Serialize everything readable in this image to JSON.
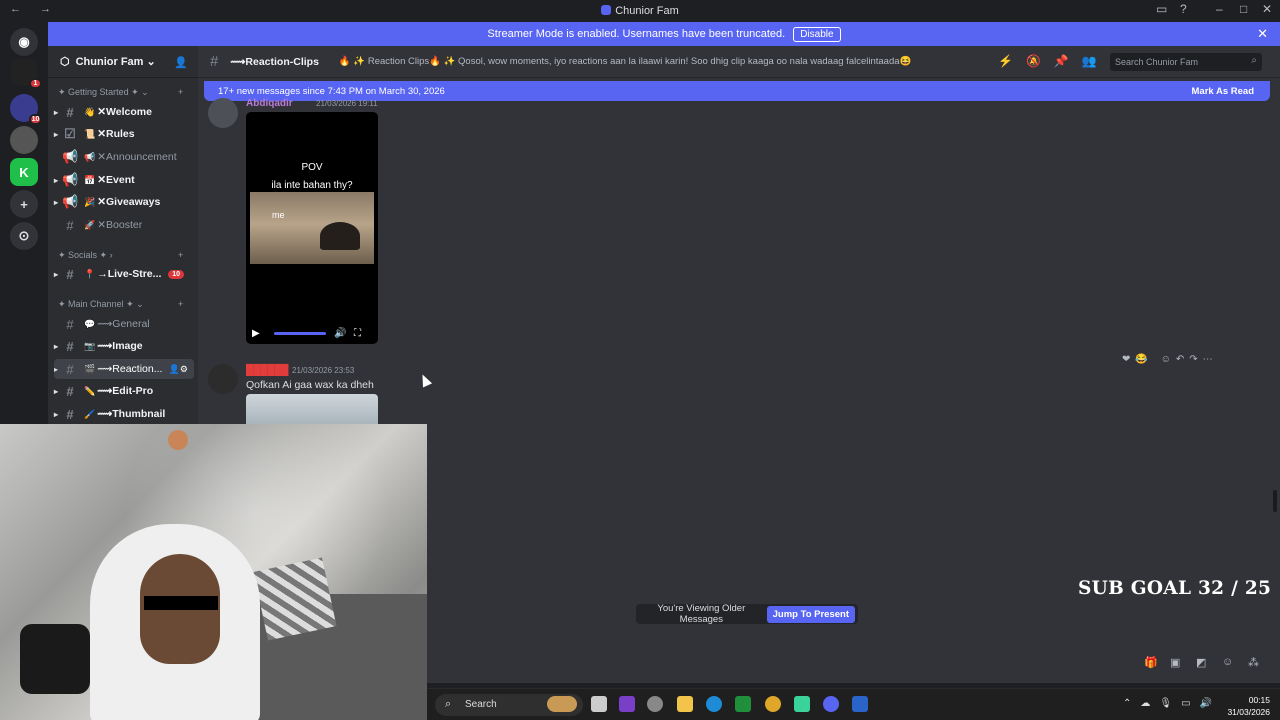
{
  "window": {
    "title": "Chunior Fam"
  },
  "banner": {
    "text": "Streamer Mode is enabled. Usernames have been truncated.",
    "button": "Disable"
  },
  "server": {
    "name": "Chunior Fam ⌄"
  },
  "sidebar": {
    "categories": [
      "✦ Getting Started ✦ ⌄",
      "✦ Socials ✦ ›",
      "✦ Main Channel ✦ ⌄"
    ],
    "channels": [
      {
        "emoji": "👋",
        "label": "✕Welcome"
      },
      {
        "emoji": "📜",
        "label": "✕Rules"
      },
      {
        "emoji": "📢",
        "label": "✕Announcement"
      },
      {
        "emoji": "📅",
        "label": "✕Event"
      },
      {
        "emoji": "🎉",
        "label": "✕Giveaways"
      },
      {
        "emoji": "🚀",
        "label": "✕Booster"
      },
      {
        "emoji": "📍",
        "label": "→Live-Stre...",
        "count": "10"
      },
      {
        "emoji": "💬",
        "label": "⟿General"
      },
      {
        "emoji": "📷",
        "label": "⟿Image"
      },
      {
        "emoji": "🎬",
        "label": "⟿Reaction..."
      },
      {
        "emoji": "✏️",
        "label": "⟿Edit-Pro"
      },
      {
        "emoji": "🖌️",
        "label": "⟿Thumbnail"
      }
    ]
  },
  "rail": {
    "badges": [
      "1",
      "10"
    ]
  },
  "channel_header": {
    "name": "⟿Reaction-Clips",
    "topic": "🔥 ✨ Reaction Clips🔥 ✨ Qosol, wow moments, iyo reactions aan la ilaawi karin! Soo dhig clip kaaga oo nala wadaag falcelintaada😆",
    "search_placeholder": "Search Chunior Fam"
  },
  "new_messages": {
    "text": "17+ new messages since 7:43 PM on March 30, 2026",
    "mark": "Mark As Read"
  },
  "messages": [
    {
      "user": "Abdiqadir",
      "time": "21/03/2026 19:11",
      "video_text_top": "POV",
      "video_text_2": "ila inte bahan thy?",
      "video_text_3": "me"
    },
    {
      "user": "██████",
      "time": "21/03/2026 23:53",
      "text": "Qofkan Ai gaa wax ka dheh"
    }
  ],
  "overlay": {
    "sub_goal": "SUB GOAL 32 / 25"
  },
  "older": {
    "label": "You're Viewing Older Messages",
    "jump": "Jump To Present"
  },
  "taskbar": {
    "search": "Search",
    "time": "00:15",
    "date": "31/03/2026"
  }
}
